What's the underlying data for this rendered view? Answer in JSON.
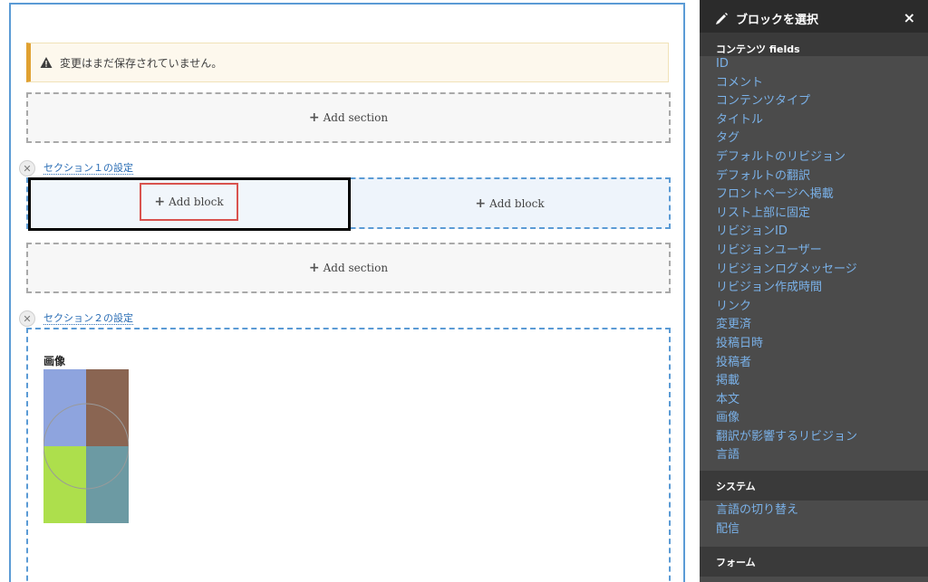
{
  "notice": {
    "text": "変更はまだ保存されていません。",
    "icon": "warning-icon",
    "accent": "#e0a132"
  },
  "layout": {
    "add_section_label": "Add section",
    "add_block_label": "Add block",
    "section1": {
      "config_label": "セクション１の設定",
      "remove_icon": "close-icon"
    },
    "section2": {
      "config_label": "セクション２の設定",
      "remove_icon": "close-icon",
      "block_label": "画像"
    }
  },
  "sidebar": {
    "title": "ブロックを選択",
    "close_label": "×",
    "categories": [
      {
        "label": "コンテンツ fields",
        "items": [
          "ID",
          "コメント",
          "コンテンツタイプ",
          "タイトル",
          "タグ",
          "デフォルトのリビジョン",
          "デフォルトの翻訳",
          "フロントページへ掲載",
          "リスト上部に固定",
          "リビジョンID",
          "リビジョンユーザー",
          "リビジョンログメッセージ",
          "リビジョン作成時間",
          "リンク",
          "変更済",
          "投稿日時",
          "投稿者",
          "掲載",
          "本文",
          "画像",
          "翻訳が影響するリビジョン",
          "言語"
        ]
      },
      {
        "label": "システム",
        "items": [
          "言語の切り替え",
          "配信"
        ]
      },
      {
        "label": "フォーム",
        "items": []
      }
    ]
  },
  "colors": {
    "link": "#7ab1e8",
    "accent_blue": "#5b9bd5",
    "highlight_red": "#d9534f"
  }
}
